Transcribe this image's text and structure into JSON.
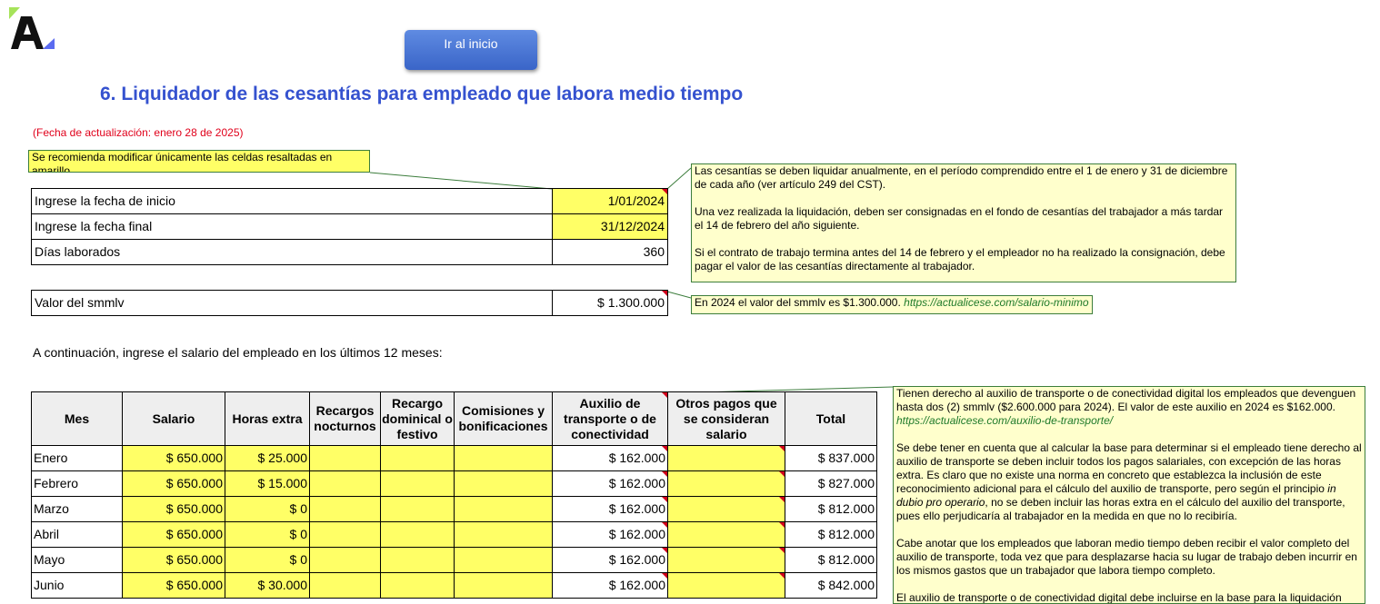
{
  "header": {
    "home_button": "Ir al inicio",
    "title": "6. Liquidador de las cesantías para empleado que labora medio tiempo",
    "update_date": "(Fecha de actualización: enero 28 de 2025)"
  },
  "notes": {
    "recommend": "Se recomienda modificar únicamente las celdas resaltadas en amarillo",
    "cesantias": [
      "Las cesantías se deben liquidar anualmente, en el período comprendido entre el 1 de enero y 31 de diciembre de cada año (ver artículo 249 del CST).",
      "Una vez realizada la liquidación, deben ser consignadas en el fondo de cesantías del trabajador a más tardar el 14 de febrero del año siguiente.",
      "Si el contrato de trabajo termina antes del 14 de febrero y el empleador no ha realizado la consignación, debe pagar el valor de las cesantías directamente al trabajador."
    ],
    "smmlv_text": "En 2024 el valor del smmlv es $1.300.000. ",
    "smmlv_link": "https://actualicese.com/salario-minimo",
    "auxilio_p1": "Tienen derecho al auxilio de transporte o de conectividad digital los empleados que devenguen hasta dos (2) smmlv ($2.600.000 para 2024). El valor de este auxilio en 2024 es $162.000. ",
    "auxilio_link": "https://actualicese.com/auxilio-de-transporte/",
    "auxilio_p2a": "Se debe tener en cuenta que al calcular la base para determinar si el empleado tiene derecho al auxilio de transporte se deben incluir todos los pagos salariales, con excepción de las horas extra. Es claro que no existe una norma en concreto que establezca la inclusión de este reconocimiento adicional para el cálculo del auxilio de transporte, pero según el principio ",
    "auxilio_p2i": "in dubio pro operario",
    "auxilio_p2b": ", no se deben incluir las horas extra en el cálculo del auxilio del transporte, pues ello perjudicaría al trabajador en la medida en que no lo recibiría.",
    "auxilio_p3": "Cabe anotar que los empleados que laboran medio tiempo deben recibir el valor completo del auxilio de transporte, toda vez que para desplazarse hacia su lugar de trabajo deben incurrir en los mismos gastos que un trabajador que labora tiempo completo.",
    "auxilio_p4": "El auxilio de transporte o de conectividad digital debe incluirse en la base para la liquidación"
  },
  "form": {
    "start_label": "Ingrese la fecha de inicio",
    "start_value": "1/01/2024",
    "end_label": "Ingrese la fecha final",
    "end_value": "31/12/2024",
    "days_label": "Días laborados",
    "days_value": "360",
    "smmlv_label": "Valor del smmlv",
    "smmlv_value": "$ 1.300.000"
  },
  "intro": "A continuación, ingrese el salario del empleado en los últimos 12 meses:",
  "table": {
    "headers": [
      "Mes",
      "Salario",
      "Horas extra",
      "Recargos nocturnos",
      "Recargo dominical o festivo",
      "Comisiones y bonificaciones",
      "Auxilio de transporte o de conectividad",
      "Otros pagos que se consideran salario",
      "Total"
    ],
    "rows": [
      [
        "Enero",
        "$ 650.000",
        "$ 25.000",
        "",
        "",
        "",
        "$ 162.000",
        "",
        "$ 837.000"
      ],
      [
        "Febrero",
        "$ 650.000",
        "$ 15.000",
        "",
        "",
        "",
        "$ 162.000",
        "",
        "$ 827.000"
      ],
      [
        "Marzo",
        "$ 650.000",
        "$ 0",
        "",
        "",
        "",
        "$ 162.000",
        "",
        "$ 812.000"
      ],
      [
        "Abril",
        "$ 650.000",
        "$ 0",
        "",
        "",
        "",
        "$ 162.000",
        "",
        "$ 812.000"
      ],
      [
        "Mayo",
        "$ 650.000",
        "$ 0",
        "",
        "",
        "",
        "$ 162.000",
        "",
        "$ 812.000"
      ],
      [
        "Junio",
        "$ 650.000",
        "$ 30.000",
        "",
        "",
        "",
        "$ 162.000",
        "",
        "$ 842.000"
      ]
    ]
  },
  "colors": {
    "title": "#3552cf",
    "highlight": "#ffff66",
    "note": "#ffffcc",
    "date": "#e0001b"
  }
}
